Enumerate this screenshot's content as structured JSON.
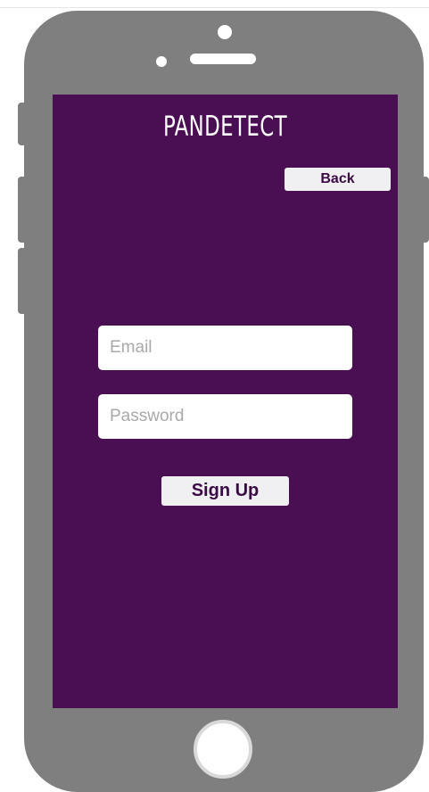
{
  "app": {
    "title": "PANDETECT"
  },
  "header": {
    "back_label": "Back"
  },
  "form": {
    "email": {
      "value": "",
      "placeholder": "Email"
    },
    "password": {
      "value": "",
      "placeholder": "Password"
    },
    "submit_label": "Sign Up"
  },
  "colors": {
    "screen_background": "#4a0e52",
    "device_frame": "#7f7f7f",
    "button_background": "#f0eff1",
    "button_text": "#3a0a44"
  }
}
